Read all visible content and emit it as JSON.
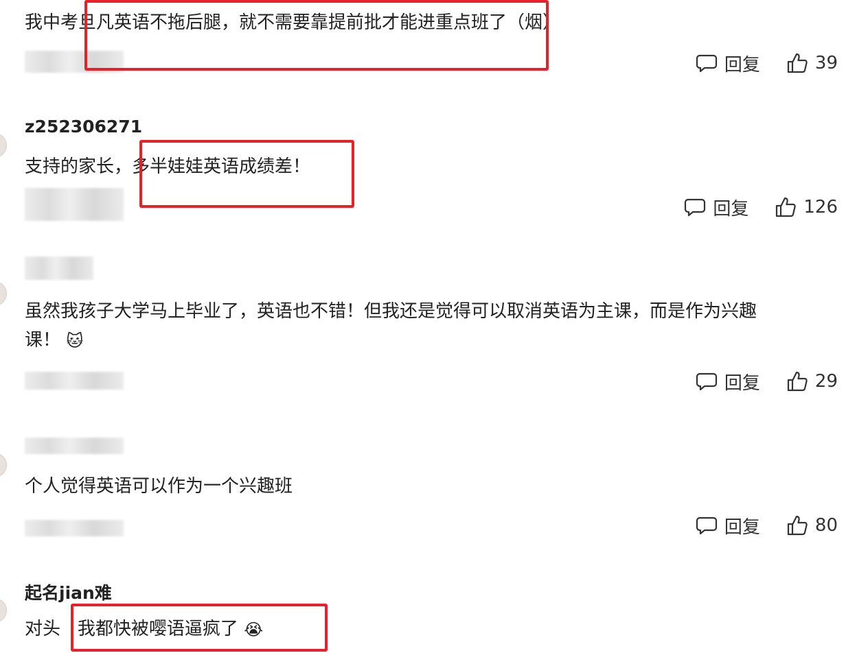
{
  "comments": [
    {
      "text_before": "我中考",
      "text_highlight": "旦凡英语不拖后腿，就不需要靠提前批才能进重点班了",
      "text_after": "（烟）",
      "reply_label": "回复",
      "likes": "39"
    },
    {
      "username": "z252306271",
      "text_before": "支持的家长，",
      "text_highlight": "多半娃娃英语成绩差！",
      "reply_label": "回复",
      "likes": "126"
    },
    {
      "text_line1": "虽然我孩子大学马上毕业了，英语也不错！但我还是觉得可以取消英语为主课，而是作为兴趣",
      "text_line2": "课！",
      "emoji": "🐱",
      "reply_label": "回复",
      "likes": "29"
    },
    {
      "text": "个人觉得英语可以作为一个兴趣班",
      "reply_label": "回复",
      "likes": "80"
    },
    {
      "username": "起名jian难",
      "text_before": "对头",
      "text_highlight": "我都快被嘤语逼疯了",
      "emoji": "😭"
    }
  ],
  "colors": {
    "highlight": "#e8202a",
    "text": "#222222"
  },
  "icons": {
    "reply": "speech-bubble-icon",
    "like": "thumbs-up-icon"
  }
}
